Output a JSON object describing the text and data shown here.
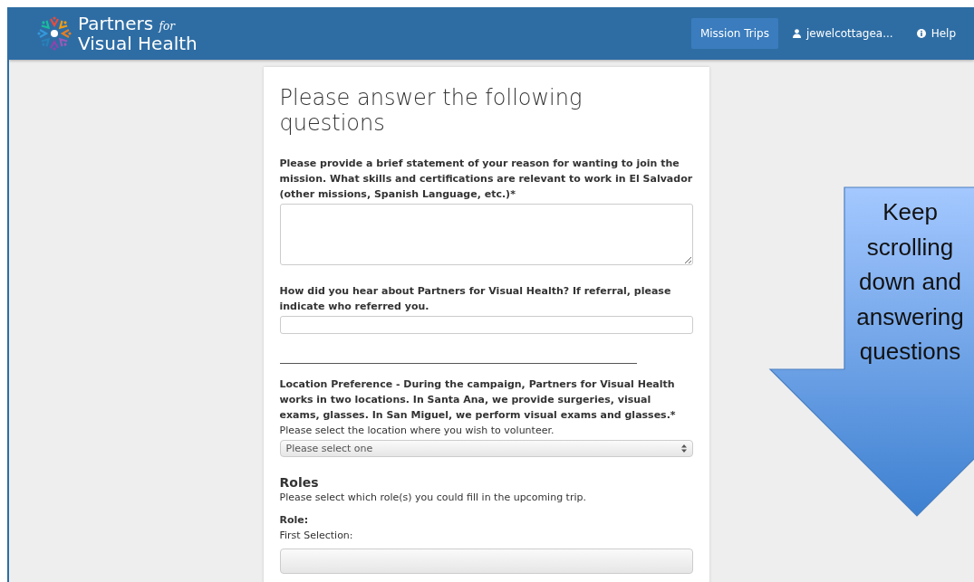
{
  "header": {
    "logo": {
      "line1": "Partners",
      "small": "for",
      "line2": "Visual Health"
    },
    "nav": [
      {
        "label": "Mission Trips",
        "kind": "link",
        "selected": true
      },
      {
        "label": "jewelcottagea...",
        "kind": "user",
        "selected": false
      },
      {
        "label": "Help",
        "kind": "info",
        "selected": false
      }
    ]
  },
  "form": {
    "title": "Please answer the following questions",
    "fields": [
      {
        "kind": "textarea",
        "label": "Please provide a brief statement of your reason for wanting to join the mission. What skills and certifications are relevant to work in El Salvador (other missions, Spanish Language, etc.)*"
      },
      {
        "kind": "input",
        "label": "How did you hear about Partners for Visual Health? If referral, please indicate who referred you."
      },
      {
        "kind": "rule"
      },
      {
        "kind": "select",
        "label": "Location Preference - During the campaign, Partners for Visual Health works in two locations. In Santa Ana, we provide surgeries, visual exams, glasses. In San Miguel, we perform visual exams and glasses.*",
        "help": "Please select the location where you wish to volunteer.",
        "placeholder": "Please select one"
      },
      {
        "kind": "heading",
        "label": "Roles",
        "help": "Please select which role(s) you could fill in the upcoming trip."
      },
      {
        "kind": "cutselect",
        "label": "Role:",
        "help": "First Selection:"
      }
    ]
  },
  "callout": {
    "text": "Keep scrolling down and answering questions"
  }
}
